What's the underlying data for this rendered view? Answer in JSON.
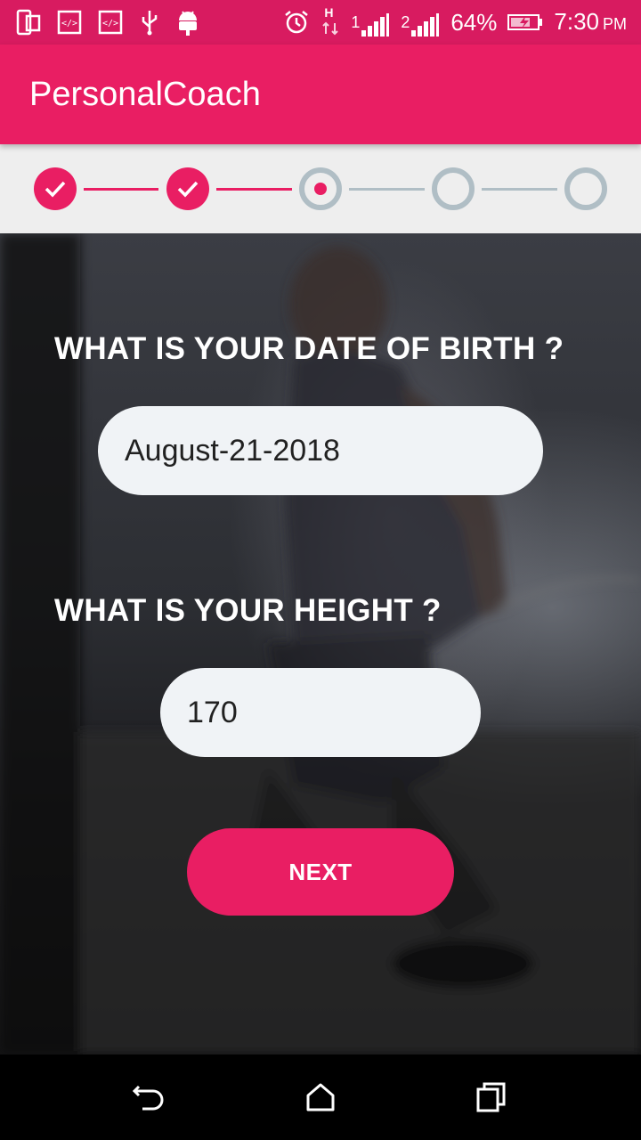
{
  "status_bar": {
    "left_icons": [
      "screen-mirror-icon",
      "code-icon",
      "code-icon",
      "usb-icon",
      "android-icon"
    ],
    "right_icons": [
      "alarm-icon",
      "data-arrows-icon",
      "signal-1-icon",
      "signal-2-icon",
      "battery-charging-icon"
    ],
    "data_type": "H",
    "sim1_label": "1",
    "sim2_label": "2",
    "battery_percent": "64%",
    "time": "7:30",
    "ampm": "PM"
  },
  "app_bar": {
    "title": "PersonalCoach"
  },
  "stepper": {
    "steps": [
      "completed",
      "completed",
      "current",
      "pending",
      "pending"
    ]
  },
  "form": {
    "dob_question": "WHAT IS YOUR DATE OF BIRTH ?",
    "dob_value": "August-21-2018",
    "height_question": "WHAT IS YOUR HEIGHT ?",
    "height_value": "170",
    "next_label": "NEXT"
  },
  "nav_bar": {
    "buttons": [
      "back-icon",
      "home-icon",
      "recents-icon"
    ]
  },
  "colors": {
    "accent": "#e91e63",
    "status_bar": "#d81b60",
    "step_inactive": "#b0bec5",
    "field_bg": "#f0f3f6"
  }
}
